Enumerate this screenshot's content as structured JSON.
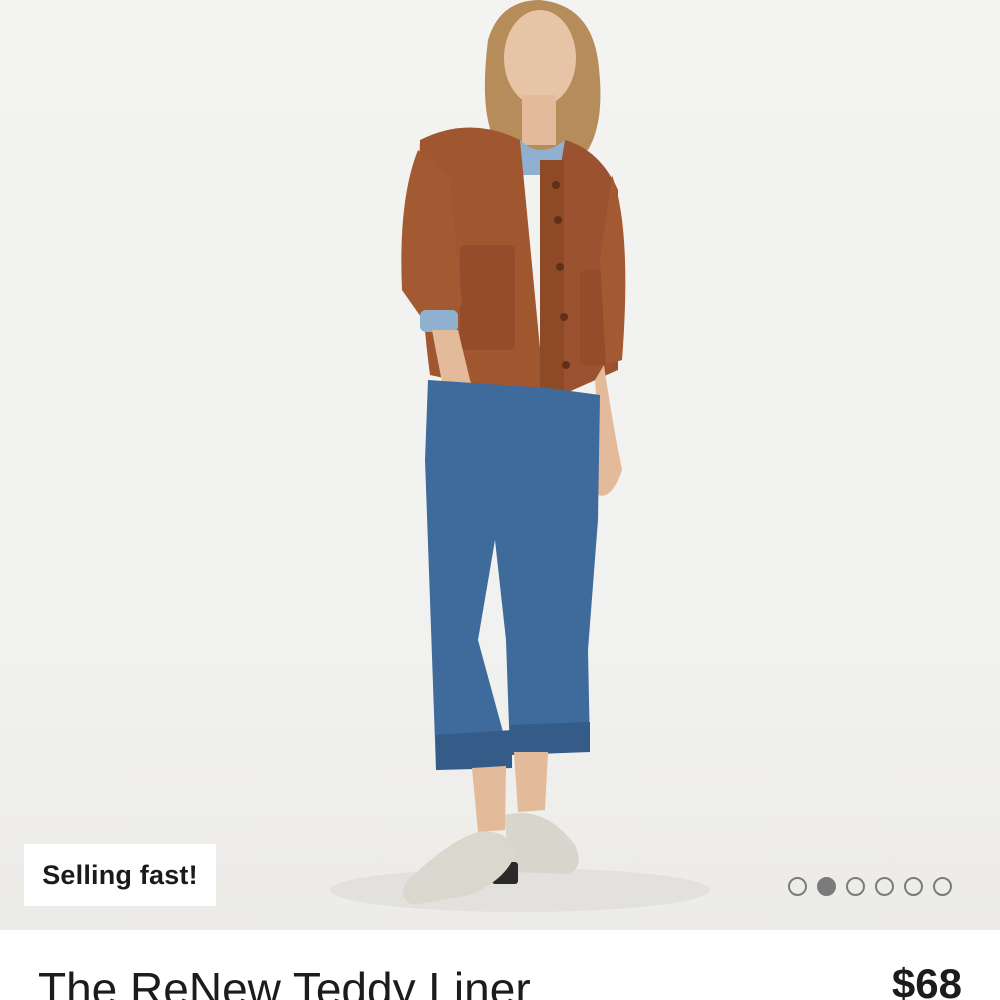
{
  "product": {
    "badge": "Selling fast!",
    "title": "The ReNew Teddy Liner",
    "price": "$68"
  },
  "carousel": {
    "total": 6,
    "active_index": 1
  },
  "colors": {
    "jacket": "#a0572f",
    "denim": "#3f6a9c",
    "background": "#f2f2f0"
  }
}
